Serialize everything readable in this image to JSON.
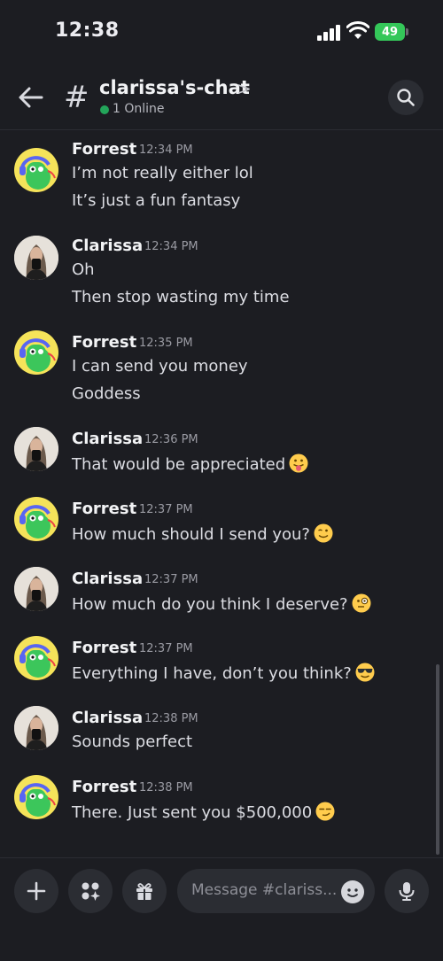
{
  "status_bar": {
    "time": "12:38",
    "battery": "49"
  },
  "header": {
    "channel_name": "clarissa's-chat",
    "online_text": "1 Online"
  },
  "messages": [
    {
      "author": "Forrest",
      "time": "12:34 PM",
      "avatar": "robot-avatar",
      "lines": [
        "I’m not really either lol",
        "It’s just a fun fantasy"
      ]
    },
    {
      "author": "Clarissa",
      "time": "12:34 PM",
      "avatar": "photo-avatar",
      "lines": [
        "Oh",
        "Then stop wasting my time"
      ]
    },
    {
      "author": "Forrest",
      "time": "12:35 PM",
      "avatar": "robot-avatar",
      "lines": [
        "I can send you money",
        "Goddess"
      ]
    },
    {
      "author": "Clarissa",
      "time": "12:36 PM",
      "avatar": "photo-avatar",
      "lines": [
        "That would be appreciated"
      ],
      "emoji": "tongue-out-emoji"
    },
    {
      "author": "Forrest",
      "time": "12:37 PM",
      "avatar": "robot-avatar",
      "lines": [
        "How much should I send you?"
      ],
      "emoji": "wink-emoji"
    },
    {
      "author": "Clarissa",
      "time": "12:37 PM",
      "avatar": "photo-avatar",
      "lines": [
        "How much do you think I deserve?"
      ],
      "emoji": "monocle-emoji"
    },
    {
      "author": "Forrest",
      "time": "12:37 PM",
      "avatar": "robot-avatar",
      "lines": [
        "Everything I have, don’t you think?"
      ],
      "emoji": "sunglasses-emoji"
    },
    {
      "author": "Clarissa",
      "time": "12:38 PM",
      "avatar": "photo-avatar",
      "lines": [
        "Sounds perfect"
      ]
    },
    {
      "author": "Forrest",
      "time": "12:38 PM",
      "avatar": "robot-avatar",
      "lines": [
        "There. Just sent you $500,000"
      ],
      "emoji": "smirk-emoji"
    }
  ],
  "composer": {
    "placeholder": "Message #clariss..."
  },
  "colors": {
    "background": "#1c1d22",
    "online": "#23a55a",
    "battery": "#34c759"
  }
}
